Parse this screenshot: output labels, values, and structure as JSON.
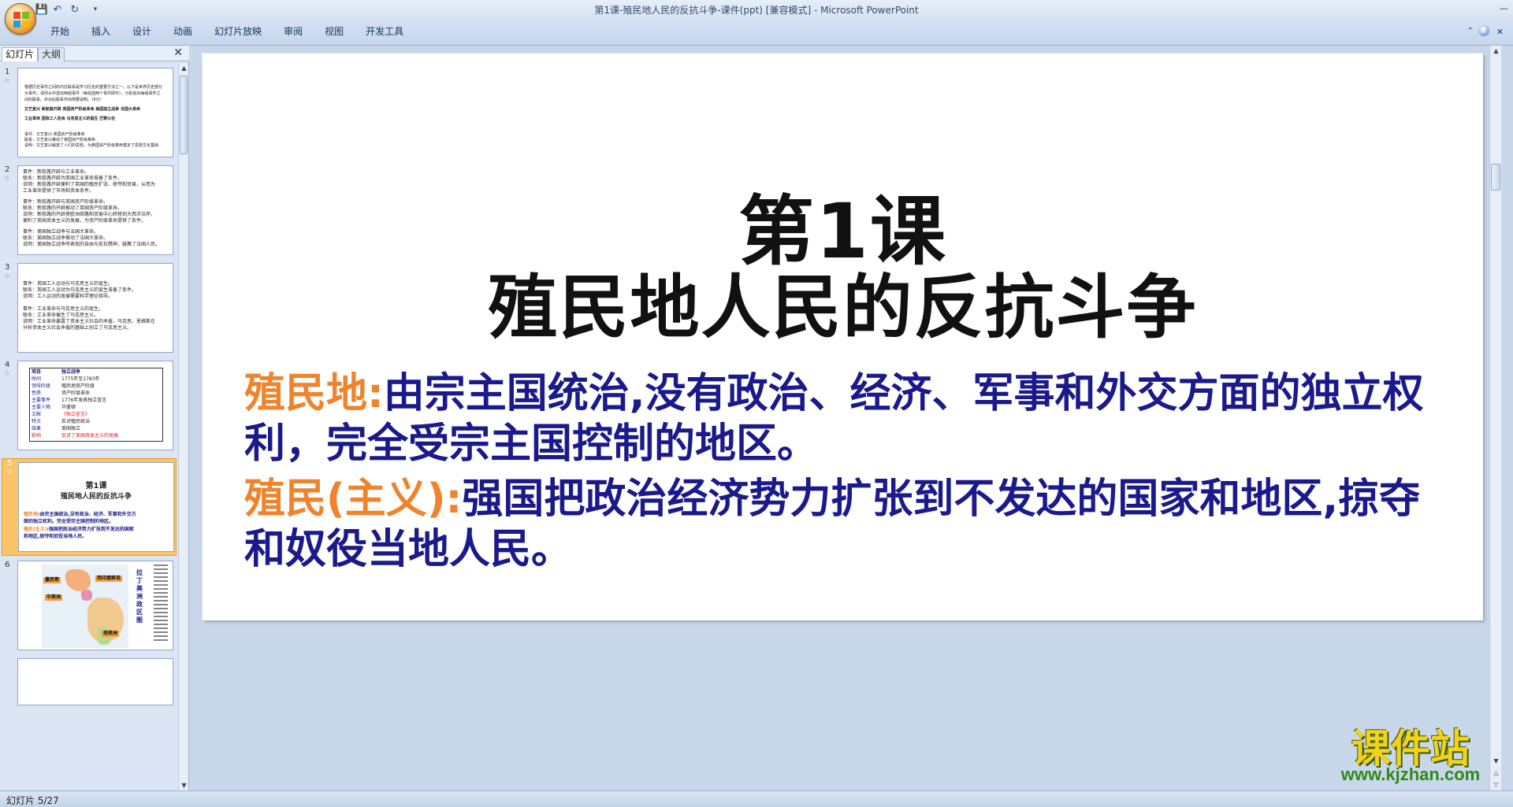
{
  "window": {
    "title": "第1课-殖民地人民的反抗斗争-课件(ppt) [兼容模式] - Microsoft PowerPoint"
  },
  "ribbon": {
    "tabs": [
      "开始",
      "插入",
      "设计",
      "动画",
      "幻灯片放映",
      "审阅",
      "视图",
      "开发工具"
    ]
  },
  "left_pane": {
    "tabs": [
      "幻灯片",
      "大纲"
    ],
    "thumbnails": [
      {
        "num": "1",
        "lines": [
          "根据历史事件之间的内在联系是学习历史的重要方法之一。以下是世界历史部分",
          "大事件，请你从中选出两组事件（每组选两个事件即可），分别说出每组事件之",
          "间的联系，并对此联系作出简要说明。（6分）",
          "文艺复兴  新航路开辟  英国资产阶级革命  美国独立战争  法国大革命",
          "工业革命  国际工人协会  马克思主义的诞生  巴黎公社",
          "事件：文艺复兴  英国资产阶级革命",
          "联系：文艺复兴推动了英国资产阶级革命",
          "说明：文艺复兴解放了人们的思想，为英国资产阶级革命奠定了思想文化基础"
        ]
      },
      {
        "num": "2",
        "lines": [
          "事件：新航路开辟与工业革命。",
          "联系：新航路开辟为英国工业革命准备了条件。",
          "说明：新航路开辟便利了英国的殖民扩张、掠夺和贸易，从而为",
          "工业革命提供了市场和资本条件。",
          "事件：新航路开辟与英国资产阶级革命。",
          "联系：新航路的开辟推动了英国资产阶级革命。",
          "说明：新航路的开辟使欧洲商路和贸易中心转移到大西洋沿岸，",
          "便利了英国资本主义的发展，为资产阶级革命提供了条件。",
          "事件：美国独立战争与法国大革命。",
          "联系：美国独立战争推动了法国大革命。",
          "说明：美国独立战争所表现的自由与反抗精神，鼓舞了法国人民。"
        ]
      },
      {
        "num": "3",
        "lines": [
          "事件：英国工人运动与马克思主义的诞生。",
          "联系：英国工人运动为马克思主义的诞生准备了条件。",
          "说明：工人运动的发展需要科学理论指导。",
          "事件：工业革命与马克思主义的诞生。",
          "联系：工业革命催生了马克思主义。",
          "说明：工业革命暴露了资本主义社会的矛盾，马克思、恩格斯在",
          "分析资本主义社会矛盾的基础上创立了马克思主义。"
        ]
      },
      {
        "num": "4",
        "rows": [
          [
            "项目",
            "独立战争"
          ],
          [
            "时间",
            "1775年至1783年"
          ],
          [
            "领导阶级",
            "殖民地资产阶级"
          ],
          [
            "性质",
            "资产阶级革命"
          ],
          [
            "主要事件",
            "1776年发表独立宣言"
          ],
          [
            "主要人物",
            "华盛顿"
          ],
          [
            "文献",
            "《独立宣言》"
          ],
          [
            "特点",
            "反对殖民统治"
          ],
          [
            "结果",
            "美国独立"
          ],
          [
            "影响",
            "促进了美国资本主义的发展"
          ]
        ]
      },
      {
        "num": "5",
        "title_1": "第1课",
        "title_2": "殖民地人民的反抗斗争",
        "line_1_term": "殖民地",
        "line_1_text": ":由宗主国统治,没有政治、经济、军事和外交方",
        "line_2_text": "面的独立权利。完全受宗主国控制的地区。",
        "line_3_term": "殖民(主义)",
        "line_3_text": ":强国把政治经济势力扩张到不发达的国家",
        "line_4_text": "和地区,掠夺和奴役当地人民。"
      },
      {
        "num": "6",
        "map_labels": [
          "墨西哥",
          "中美洲",
          "西印度群岛",
          "南美洲"
        ],
        "side_caption": "拉丁美洲政区图"
      }
    ]
  },
  "slide": {
    "title_line_1": "第1课",
    "title_line_2": "殖民地人民的反抗斗争",
    "definition_1": {
      "term": "殖民地:",
      "text": "由宗主国统治,没有政治、经济、军事和外交方面的独立权利，完全受宗主国控制的地区。"
    },
    "definition_2": {
      "term": "殖民(主义):",
      "text": "强国把政治经济势力扩张到不发达的国家和地区,掠夺和奴役当地人民。"
    },
    "colors": {
      "term": "#f0832c",
      "body": "#1a1a8c",
      "title": "#111111"
    }
  },
  "watermark": {
    "title": "课件站",
    "url": "www.kjzhan.com"
  },
  "status_bar": {
    "text": "幻灯片 5/27"
  }
}
